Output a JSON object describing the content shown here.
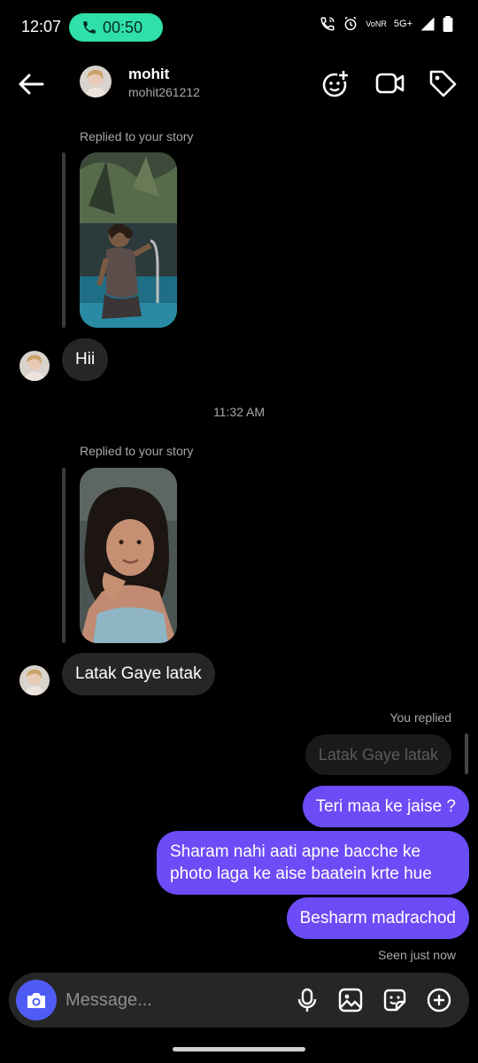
{
  "status_bar": {
    "time": "12:07",
    "call_timer": "00:50",
    "network_top": "Vo",
    "network_bottom": "NR",
    "network_type": "5G+"
  },
  "header": {
    "name": "mohit",
    "username": "mohit261212"
  },
  "chat": {
    "story_reply_label_1": "Replied to your story",
    "message_1": "Hii",
    "time_separator": "11:32 AM",
    "story_reply_label_2": "Replied to your story",
    "message_2": "Latak Gaye latak",
    "you_replied_label": "You replied",
    "quoted_reply": "Latak Gaye latak",
    "outgoing": [
      "Teri maa ke jaise ?",
      "Sharam nahi aati apne bacche ke photo laga ke aise baatein krte hue",
      "Besharm madrachod"
    ],
    "seen_status": "Seen just now"
  },
  "composer": {
    "placeholder": "Message..."
  },
  "colors": {
    "call_pill": "#2fe0a9",
    "outgoing_bubble": "#6c4cf6",
    "camera_button": "#4e5cf5",
    "incoming_bubble": "#262626"
  },
  "icons": [
    "phone-icon",
    "back-arrow-icon",
    "add-sticker-icon",
    "video-call-icon",
    "tag-icon",
    "camera-icon",
    "mic-icon",
    "gallery-icon",
    "sticker-icon",
    "plus-circle-icon"
  ]
}
